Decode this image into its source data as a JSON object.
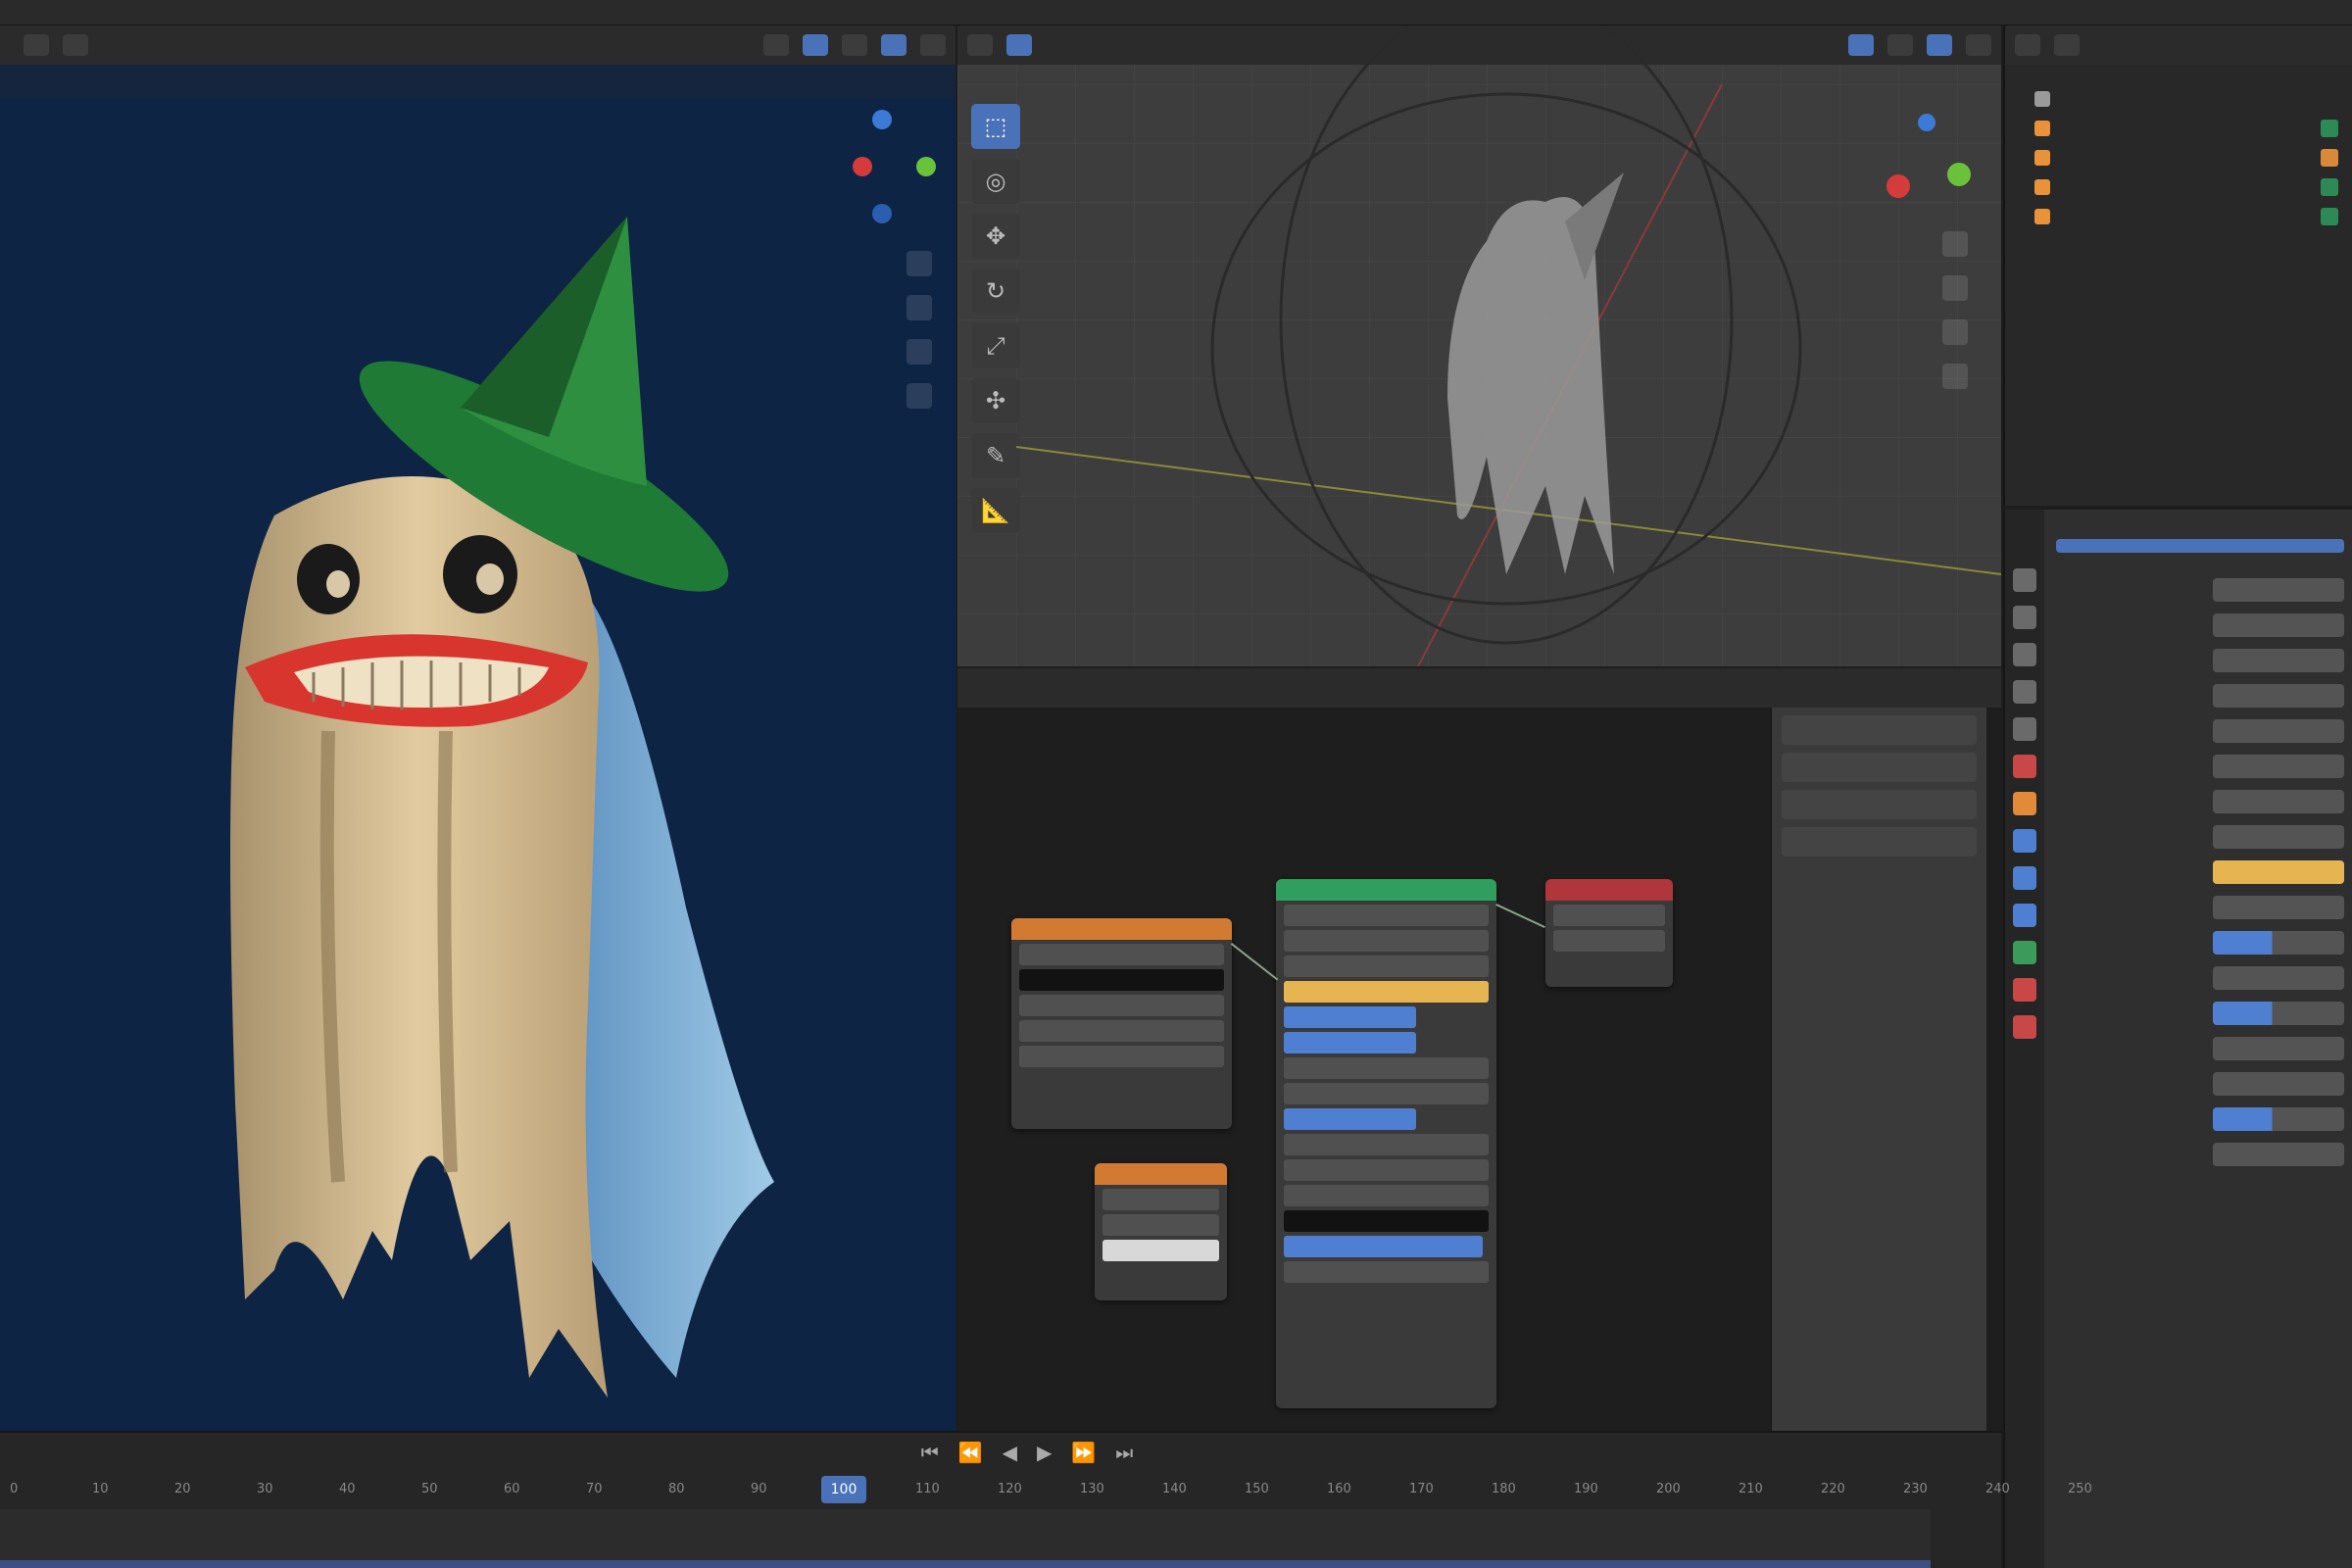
{
  "topbar": {
    "items": [
      "",
      "",
      "",
      "",
      "",
      "",
      "",
      "",
      ""
    ]
  },
  "render_view": {
    "header_label": "",
    "menu": [
      "",
      "",
      "",
      ""
    ]
  },
  "solid_view": {
    "header_label": "",
    "info_line1": "",
    "info_line2": "",
    "tools": [
      "cursor-icon",
      "select-circle-icon",
      "move-icon",
      "rotate-icon",
      "scale-icon",
      "transform-icon",
      "annotate-icon",
      "measure-icon"
    ]
  },
  "outliner": {
    "items": [
      "",
      "",
      "",
      "",
      ""
    ]
  },
  "properties": {
    "rows": [
      "",
      "",
      "",
      "",
      "",
      "",
      "",
      "",
      "",
      "",
      "",
      "",
      "",
      "",
      "",
      "",
      ""
    ]
  },
  "node_editor": {
    "header_items": [
      "",
      "",
      "",
      "",
      ""
    ],
    "label": ""
  },
  "timeline": {
    "header_items": [
      "",
      ""
    ],
    "ticks": [
      "0",
      "10",
      "20",
      "30",
      "40",
      "50",
      "60",
      "70",
      "80",
      "90",
      "100",
      "110",
      "120",
      "130",
      "140",
      "150",
      "160",
      "170",
      "180",
      "190",
      "200",
      "210",
      "220",
      "230",
      "240",
      "250"
    ],
    "current_frame": "100"
  },
  "colors": {
    "accent": "#4a72b8",
    "render_bg": "#0e2445",
    "node_principled": "#2f9e5e",
    "node_output": "#b0363c",
    "node_texture": "#d27a32"
  }
}
